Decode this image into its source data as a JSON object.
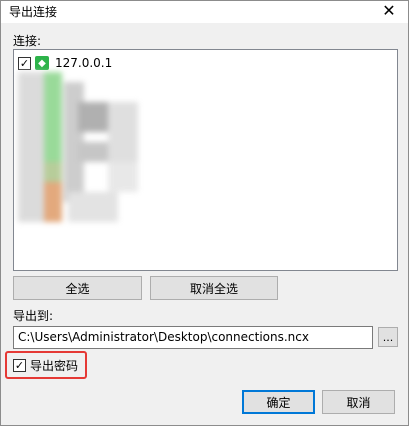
{
  "window": {
    "title": "导出连接"
  },
  "connections": {
    "label": "连接:",
    "items": [
      {
        "name": "127.0.0.1",
        "checked": true
      }
    ]
  },
  "buttons": {
    "select_all": "全选",
    "deselect_all": "取消全选",
    "ok": "确定",
    "cancel": "取消",
    "browse": "..."
  },
  "export_to": {
    "label": "导出到:",
    "path": "C:\\Users\\Administrator\\Desktop\\connections.ncx"
  },
  "export_password": {
    "label": "导出密码",
    "checked": true
  },
  "icons": {
    "close": "close-icon",
    "connection": "mysql-connection-icon",
    "check": "check-icon"
  },
  "colors": {
    "highlight_border": "#e53935",
    "primary_border": "#0078d7",
    "connection_icon": "#2db34a"
  }
}
